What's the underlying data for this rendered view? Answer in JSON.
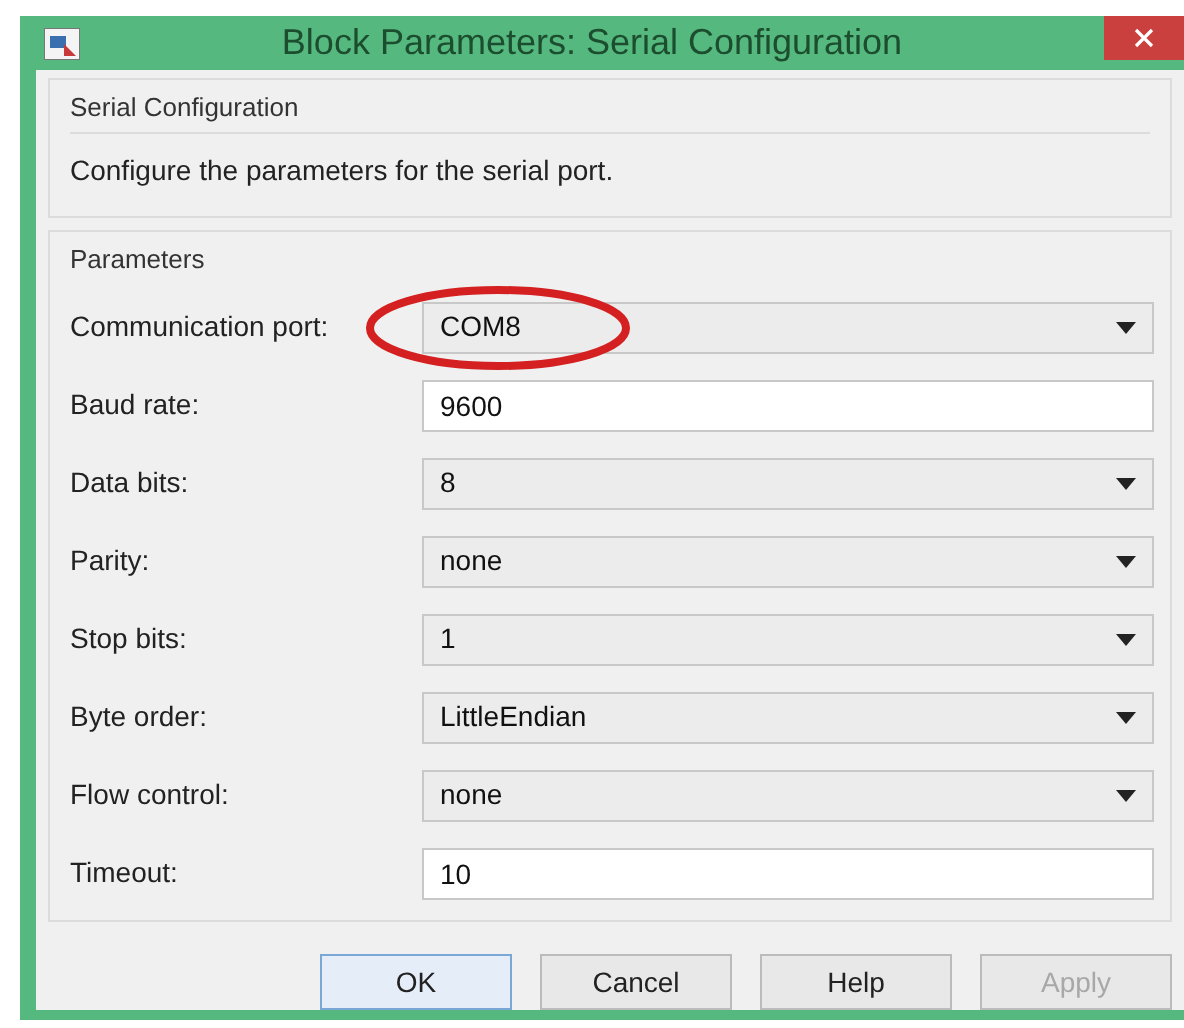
{
  "window": {
    "title": "Block Parameters: Serial Configuration"
  },
  "block": {
    "name": "Serial Configuration",
    "description": "Configure the parameters for the serial port."
  },
  "parameters_group": {
    "title": "Parameters"
  },
  "parameters": [
    {
      "label": "Communication port:",
      "kind": "dropdown",
      "value": "COM8",
      "highlighted": true
    },
    {
      "label": "Baud rate:",
      "kind": "text",
      "value": "9600",
      "highlighted": false
    },
    {
      "label": "Data bits:",
      "kind": "dropdown",
      "value": "8",
      "highlighted": false
    },
    {
      "label": "Parity:",
      "kind": "dropdown",
      "value": "none",
      "highlighted": false
    },
    {
      "label": "Stop bits:",
      "kind": "dropdown",
      "value": "1",
      "highlighted": false
    },
    {
      "label": "Byte order:",
      "kind": "dropdown",
      "value": "LittleEndian",
      "highlighted": false
    },
    {
      "label": "Flow control:",
      "kind": "dropdown",
      "value": "none",
      "highlighted": false
    },
    {
      "label": "Timeout:",
      "kind": "text",
      "value": "10",
      "highlighted": false
    }
  ],
  "buttons": [
    {
      "label": "OK",
      "disabled": false,
      "default": true
    },
    {
      "label": "Cancel",
      "disabled": false,
      "default": false
    },
    {
      "label": "Help",
      "disabled": false,
      "default": false
    },
    {
      "label": "Apply",
      "disabled": true,
      "default": false
    }
  ]
}
